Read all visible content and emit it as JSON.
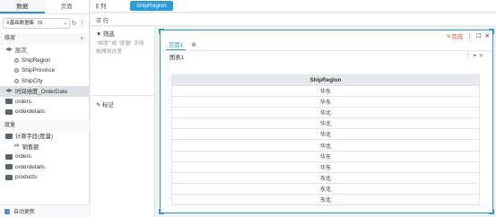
{
  "left_panel": {
    "tabs": [
      "数据",
      "页面"
    ],
    "dataset_label": "X基础数据集（S",
    "dimension_header": "维度",
    "dimension_items": [
      {
        "label": "层次",
        "indent": 0,
        "kind": "layers"
      },
      {
        "label": "ShipRegion",
        "indent": 1,
        "kind": "field"
      },
      {
        "label": "ShipProvince",
        "indent": 1,
        "kind": "field"
      },
      {
        "label": "ShipCity",
        "indent": 1,
        "kind": "field"
      },
      {
        "label": "时间维度_OrderDate",
        "indent": 0,
        "kind": "layers"
      },
      {
        "label": "orders",
        "indent": 0,
        "kind": "folder"
      },
      {
        "label": "orderdetails",
        "indent": 0,
        "kind": "folder"
      }
    ],
    "measure_header": "度量",
    "measure_items": [
      {
        "label": "计算字段(度量)",
        "indent": 0,
        "kind": "folder"
      },
      {
        "label": "销售额",
        "indent": 1,
        "kind": "calc"
      },
      {
        "label": "orders",
        "indent": 0,
        "kind": "folder"
      },
      {
        "label": "orderdetails",
        "indent": 0,
        "kind": "folder"
      },
      {
        "label": "products",
        "indent": 0,
        "kind": "folder"
      }
    ],
    "auto_update": "自动更新"
  },
  "shelves": {
    "col_label": "列",
    "col_pill": "ShipRegion",
    "row_label": "行"
  },
  "filter_panel": {
    "title": "筛选",
    "hint": "\"维度\" 或 \"度量\" 字段拖拽到这里",
    "mark": "标记"
  },
  "canvas": {
    "done_label": "完成",
    "page_tab": "页面1",
    "table_title": "图表1",
    "column_header": "ShipRegion",
    "rows": [
      "华东",
      "华东",
      "华北",
      "华北",
      "华北",
      "华北",
      "华东",
      "华东",
      "东北",
      "东北",
      "东北"
    ]
  },
  "colors": {
    "accent": "#2a9ad8",
    "done": "#d9503f"
  }
}
